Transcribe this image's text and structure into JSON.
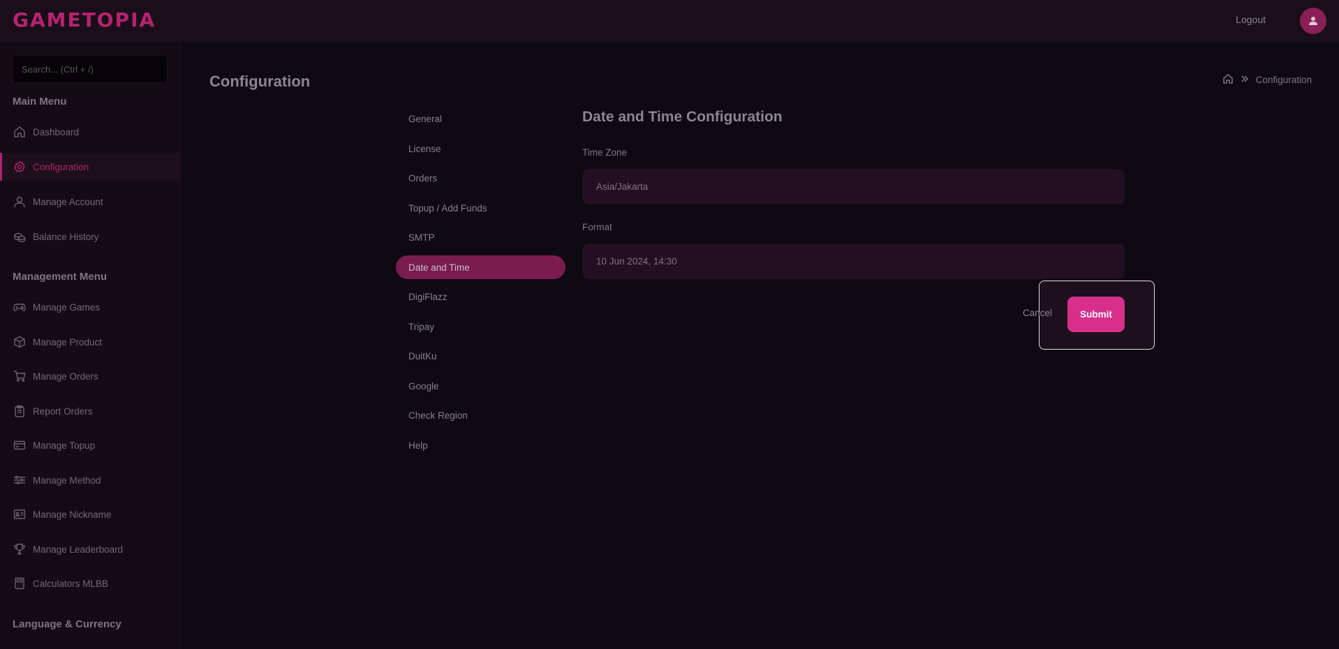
{
  "app": {
    "logo": "GAMETOPIA",
    "logout_label": "Logout"
  },
  "search": {
    "placeholder": "Search... (Ctrl + /)"
  },
  "sidebar": {
    "main_menu_title": "Main Menu",
    "main_items": [
      {
        "label": "Dashboard",
        "icon": "home-icon"
      },
      {
        "label": "Configuration",
        "icon": "gear-icon",
        "active": true
      },
      {
        "label": "Manage Account",
        "icon": "user-icon"
      },
      {
        "label": "Balance History",
        "icon": "coins-icon"
      }
    ],
    "management_menu_title": "Management Menu",
    "management_items": [
      {
        "label": "Manage Games",
        "icon": "gamepad-icon"
      },
      {
        "label": "Manage Product",
        "icon": "box-icon"
      },
      {
        "label": "Manage Orders",
        "icon": "cart-icon"
      },
      {
        "label": "Report Orders",
        "icon": "clipboard-icon"
      },
      {
        "label": "Manage Topup",
        "icon": "wallet-icon"
      },
      {
        "label": "Manage Method",
        "icon": "sliders-icon"
      },
      {
        "label": "Manage Nickname",
        "icon": "id-card-icon"
      },
      {
        "label": "Manage Leaderboard",
        "icon": "trophy-icon"
      },
      {
        "label": "Calculators MLBB",
        "icon": "calculator-icon"
      }
    ],
    "language_title": "Language & Currency"
  },
  "page": {
    "title": "Configuration",
    "breadcrumb_current": "Configuration"
  },
  "config_tabs": [
    {
      "label": "General"
    },
    {
      "label": "License"
    },
    {
      "label": "Orders"
    },
    {
      "label": "Topup / Add Funds"
    },
    {
      "label": "SMTP"
    },
    {
      "label": "Date and Time",
      "active": true
    },
    {
      "label": "DigiFlazz"
    },
    {
      "label": "Tripay"
    },
    {
      "label": "DuitKu"
    },
    {
      "label": "Google"
    },
    {
      "label": "Check Region"
    },
    {
      "label": "Help"
    }
  ],
  "form": {
    "title": "Date and Time Configuration",
    "timezone_label": "Time Zone",
    "timezone_value": "Asia/Jakarta",
    "format_label": "Format",
    "format_value": "10 Jun 2024, 14:30",
    "cancel_label": "Cancel",
    "submit_label": "Submit"
  },
  "colors": {
    "accent": "#d72f8a",
    "active_tab": "#7a1c4f",
    "background": "#0f0911"
  }
}
